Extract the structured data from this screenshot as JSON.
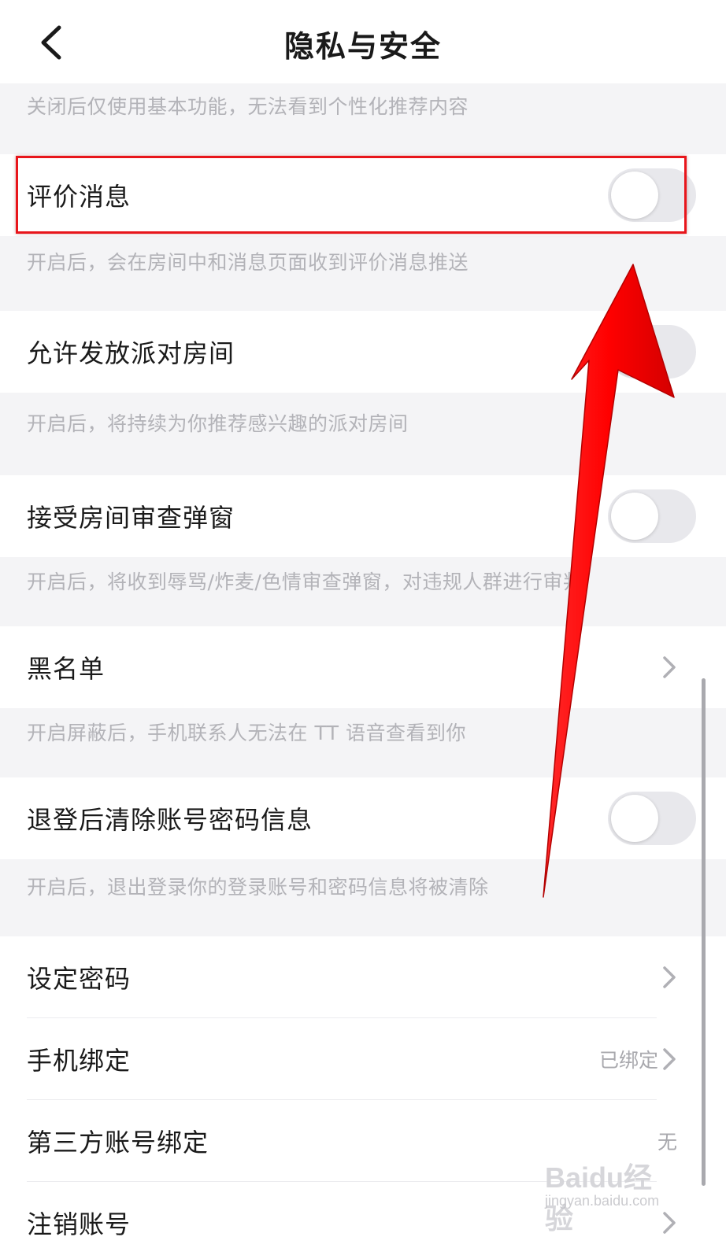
{
  "header": {
    "title": "隐私与安全"
  },
  "sections": {
    "personalized_desc": "关闭后仅使用基本功能，无法看到个性化推荐内容",
    "review": {
      "label": "评价消息",
      "desc": "开启后，会在房间中和消息页面收到评价消息推送",
      "enabled": false
    },
    "party": {
      "label": "允许发放派对房间",
      "desc": "开启后，将持续为你推荐感兴趣的派对房间",
      "enabled": false
    },
    "audit": {
      "label": "接受房间审查弹窗",
      "desc": "开启后，将收到辱骂/炸麦/色情审查弹窗，对违规人群进行审判",
      "enabled": false
    },
    "blacklist": {
      "label": "黑名单",
      "desc": "开启屏蔽后，手机联系人无法在 TT 语音查看到你"
    },
    "logout_clear": {
      "label": "退登后清除账号密码信息",
      "desc": "开启后，退出登录你的登录账号和密码信息将被清除",
      "enabled": false
    },
    "account": {
      "set_password": "设定密码",
      "phone_bind": "手机绑定",
      "phone_bind_status": "已绑定",
      "third_party_bind": "第三方账号绑定",
      "third_party_status": "无",
      "cancel_account": "注销账号"
    }
  },
  "watermark": {
    "logo": "Baidu经验",
    "url": "jingyan.baidu.com"
  },
  "colors": {
    "highlight": "#e8151b",
    "arrow": "#ff0a0a",
    "background": "#f4f4f6"
  }
}
